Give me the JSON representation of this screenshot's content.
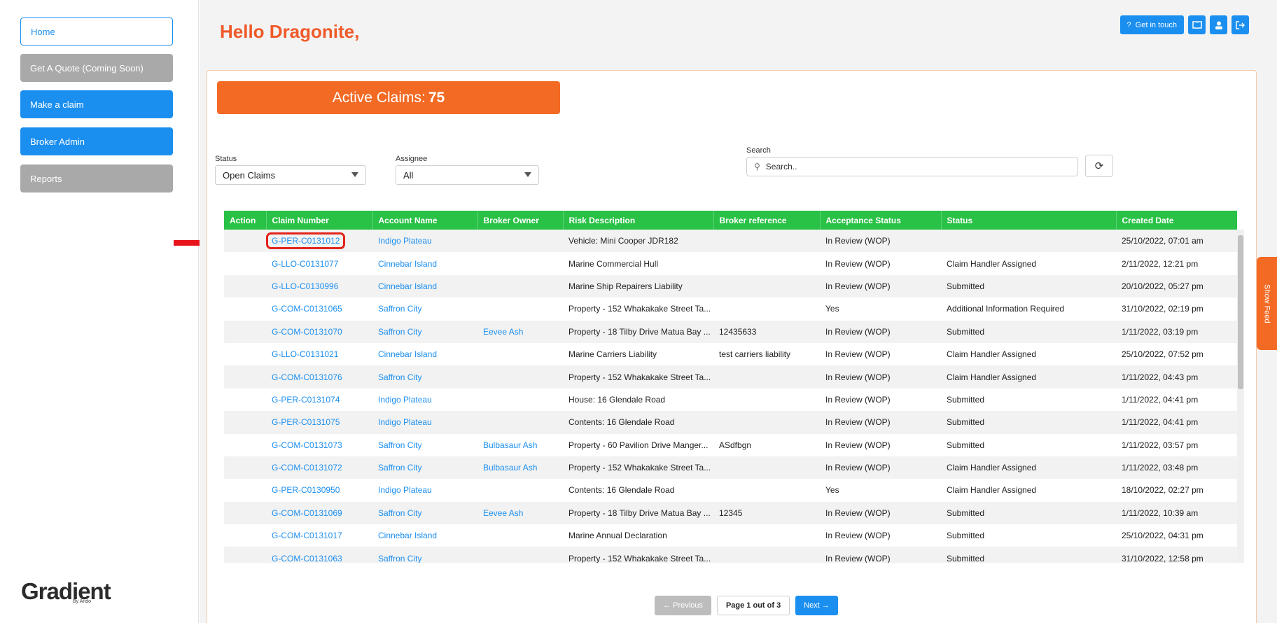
{
  "sidebar": {
    "items": [
      {
        "label": "Home"
      },
      {
        "label": "Get A Quote (Coming Soon)"
      },
      {
        "label": "Make a claim"
      },
      {
        "label": "Broker Admin"
      },
      {
        "label": "Reports"
      }
    ],
    "logo": "Gradient",
    "logo_sub": "By Ando"
  },
  "header": {
    "greeting": "Hello Dragonite,",
    "get_in_touch": "Get in touch"
  },
  "banner": {
    "label": "Active Claims:",
    "count": "75"
  },
  "filters": {
    "status_label": "Status",
    "status_value": "Open Claims",
    "assignee_label": "Assignee",
    "assignee_value": "All",
    "search_label": "Search",
    "search_placeholder": "Search.."
  },
  "table": {
    "columns": [
      "Action",
      "Claim Number",
      "Account Name",
      "Broker Owner",
      "Risk Description",
      "Broker reference",
      "Acceptance Status",
      "Status",
      "Created Date"
    ],
    "rows": [
      {
        "claim": "G-PER-C0131012",
        "account": "Indigo Plateau",
        "owner": "",
        "risk": "Vehicle: Mini Cooper JDR182",
        "ref": "",
        "acceptance": "In Review (WOP)",
        "status": "",
        "created": "25/10/2022, 07:01 am"
      },
      {
        "claim": "G-LLO-C0131077",
        "account": "Cinnebar Island",
        "owner": "",
        "risk": "Marine Commercial Hull",
        "ref": "",
        "acceptance": "In Review (WOP)",
        "status": "Claim Handler Assigned",
        "created": "2/11/2022, 12:21 pm"
      },
      {
        "claim": "G-LLO-C0130996",
        "account": "Cinnebar Island",
        "owner": "",
        "risk": "Marine Ship Repairers Liability",
        "ref": "",
        "acceptance": "In Review (WOP)",
        "status": "Submitted",
        "created": "20/10/2022, 05:27 pm"
      },
      {
        "claim": "G-COM-C0131065",
        "account": "Saffron City",
        "owner": "",
        "risk": "Property - 152 Whakakake Street Ta...",
        "ref": "",
        "acceptance": "Yes",
        "status": "Additional Information Required",
        "created": "31/10/2022, 02:19 pm"
      },
      {
        "claim": "G-COM-C0131070",
        "account": "Saffron City",
        "owner": "Eevee Ash",
        "risk": "Property - 18 Tilby Drive Matua Bay ...",
        "ref": "12435633",
        "acceptance": "In Review (WOP)",
        "status": "Submitted",
        "created": "1/11/2022, 03:19 pm"
      },
      {
        "claim": "G-LLO-C0131021",
        "account": "Cinnebar Island",
        "owner": "",
        "risk": "Marine Carriers Liability",
        "ref": "test carriers liability",
        "acceptance": "In Review (WOP)",
        "status": "Claim Handler Assigned",
        "created": "25/10/2022, 07:52 pm"
      },
      {
        "claim": "G-COM-C0131076",
        "account": "Saffron City",
        "owner": "",
        "risk": "Property - 152 Whakakake Street Ta...",
        "ref": "",
        "acceptance": "In Review (WOP)",
        "status": "Claim Handler Assigned",
        "created": "1/11/2022, 04:43 pm"
      },
      {
        "claim": "G-PER-C0131074",
        "account": "Indigo Plateau",
        "owner": "",
        "risk": "House: 16 Glendale Road",
        "ref": "",
        "acceptance": "In Review (WOP)",
        "status": "Submitted",
        "created": "1/11/2022, 04:41 pm"
      },
      {
        "claim": "G-PER-C0131075",
        "account": "Indigo Plateau",
        "owner": "",
        "risk": "Contents: 16 Glendale Road",
        "ref": "",
        "acceptance": "In Review (WOP)",
        "status": "Submitted",
        "created": "1/11/2022, 04:41 pm"
      },
      {
        "claim": "G-COM-C0131073",
        "account": "Saffron City",
        "owner": "Bulbasaur Ash",
        "risk": "Property - 60 Pavilion Drive Manger...",
        "ref": "ASdfbgn",
        "acceptance": "In Review (WOP)",
        "status": "Submitted",
        "created": "1/11/2022, 03:57 pm"
      },
      {
        "claim": "G-COM-C0131072",
        "account": "Saffron City",
        "owner": "Bulbasaur Ash",
        "risk": "Property - 152 Whakakake Street Ta...",
        "ref": "",
        "acceptance": "In Review (WOP)",
        "status": "Claim Handler Assigned",
        "created": "1/11/2022, 03:48 pm"
      },
      {
        "claim": "G-PER-C0130950",
        "account": "Indigo Plateau",
        "owner": "",
        "risk": "Contents: 16 Glendale Road",
        "ref": "",
        "acceptance": "Yes",
        "status": "Claim Handler Assigned",
        "created": "18/10/2022, 02:27 pm"
      },
      {
        "claim": "G-COM-C0131069",
        "account": "Saffron City",
        "owner": "Eevee Ash",
        "risk": "Property - 18 Tilby Drive Matua Bay ...",
        "ref": "12345",
        "acceptance": "In Review (WOP)",
        "status": "Submitted",
        "created": "1/11/2022, 10:39 am"
      },
      {
        "claim": "G-COM-C0131017",
        "account": "Cinnebar Island",
        "owner": "",
        "risk": "Marine Annual Declaration",
        "ref": "",
        "acceptance": "In Review (WOP)",
        "status": "Submitted",
        "created": "25/10/2022, 04:31 pm"
      },
      {
        "claim": "G-COM-C0131063",
        "account": "Saffron City",
        "owner": "",
        "risk": "Property - 152 Whakakake Street Ta...",
        "ref": "",
        "acceptance": "In Review (WOP)",
        "status": "Submitted",
        "created": "31/10/2022, 12:58 pm"
      }
    ]
  },
  "pagination": {
    "previous": "← Previous",
    "page": "Page 1 out of 3",
    "next": "Next →"
  },
  "feed": {
    "label": "Show Feed"
  }
}
